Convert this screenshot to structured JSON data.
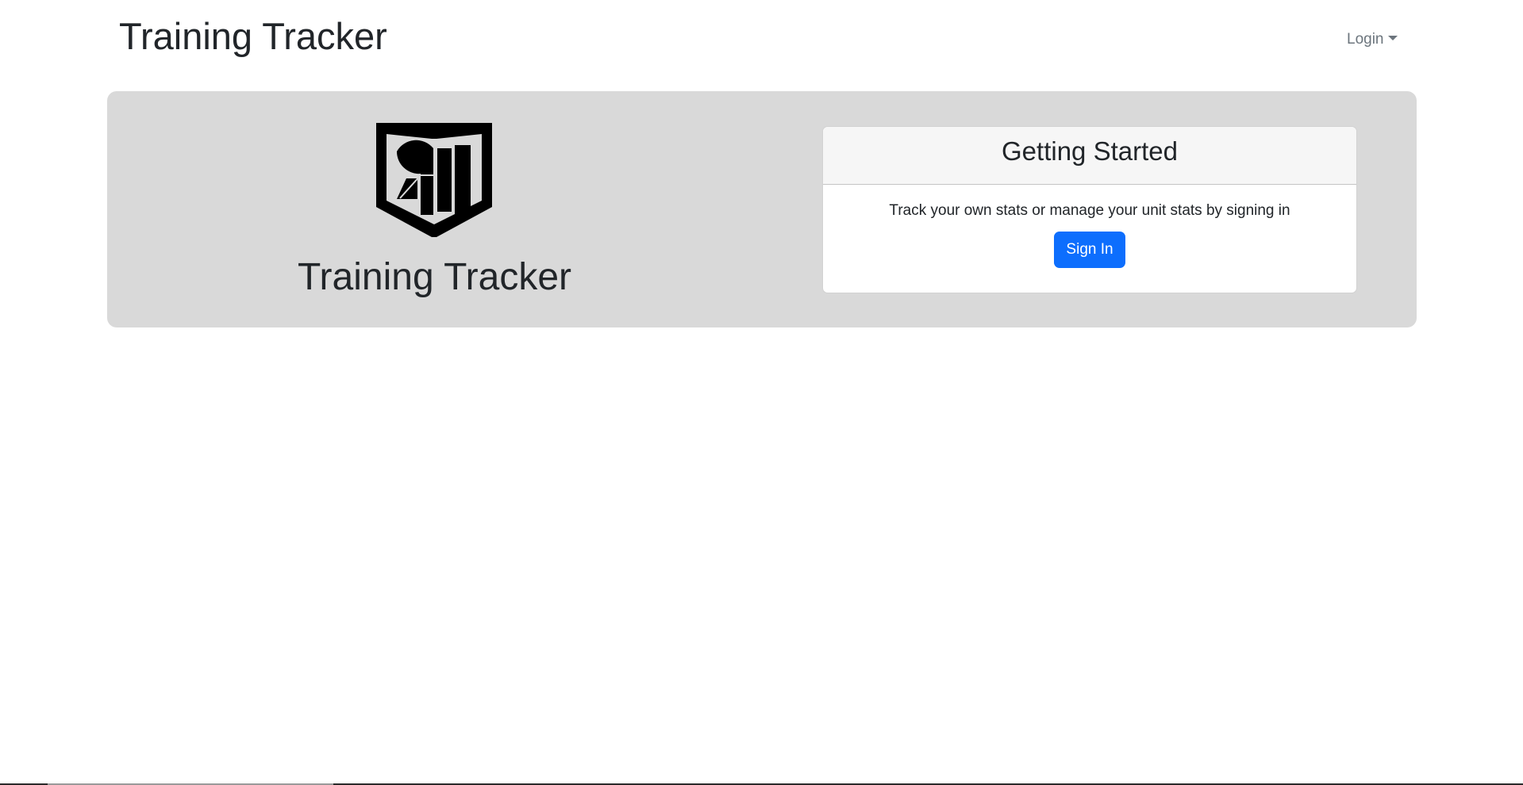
{
  "navbar": {
    "brand": "Training Tracker",
    "login_label": "Login"
  },
  "hero": {
    "logo_icon": "training-tracker-shield-logo",
    "title": "Training Tracker"
  },
  "card": {
    "header": "Getting Started",
    "text": "Track your own stats or manage your unit stats by signing in",
    "button_label": "Sign In"
  },
  "colors": {
    "hero_background": "#d9d9d9",
    "primary_button": "#0d6efd",
    "card_header_background": "#f6f6f6",
    "nav_muted": "#6c757d"
  }
}
